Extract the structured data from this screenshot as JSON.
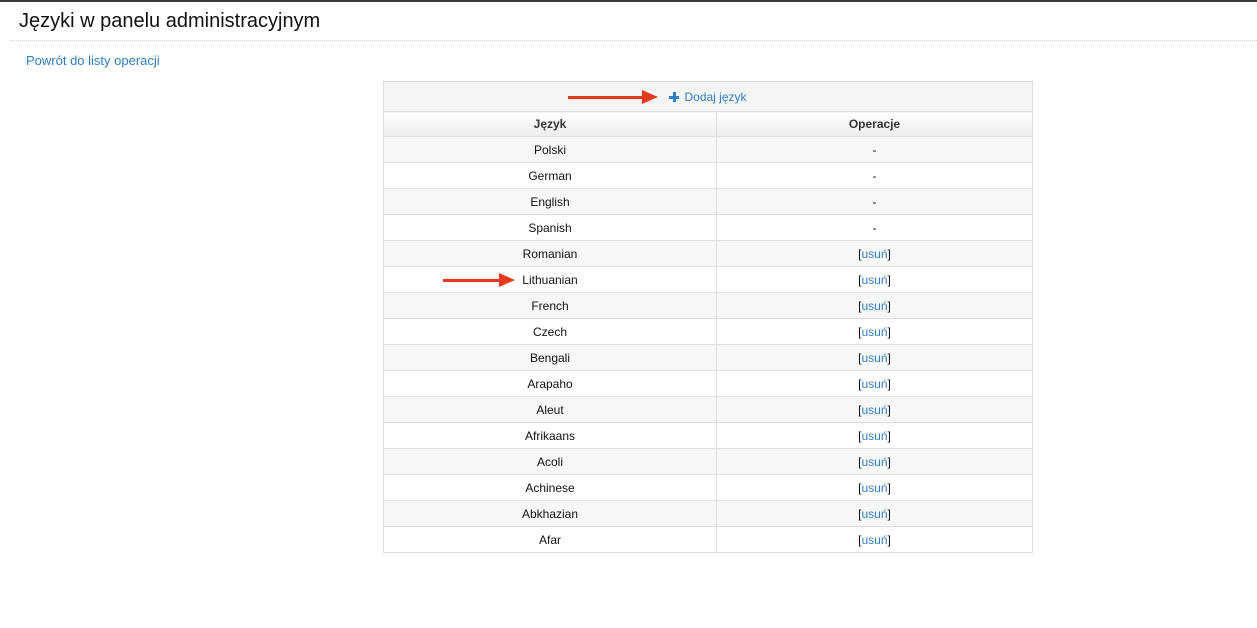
{
  "page": {
    "title": "Języki w panelu administracyjnym",
    "back_link": "Powrót do listy operacji"
  },
  "toolbar": {
    "add_language_label": "Dodaj język"
  },
  "table": {
    "headers": [
      "Język",
      "Operacje"
    ],
    "rows": [
      {
        "language": "Polski",
        "operation": "-",
        "removable": false
      },
      {
        "language": "German",
        "operation": "-",
        "removable": false
      },
      {
        "language": "English",
        "operation": "-",
        "removable": false
      },
      {
        "language": "Spanish",
        "operation": "-",
        "removable": false
      },
      {
        "language": "Romanian",
        "operation": "usuń",
        "removable": true
      },
      {
        "language": "Lithuanian",
        "operation": "usuń",
        "removable": true
      },
      {
        "language": "French",
        "operation": "usuń",
        "removable": true
      },
      {
        "language": "Czech",
        "operation": "usuń",
        "removable": true
      },
      {
        "language": "Bengali",
        "operation": "usuń",
        "removable": true
      },
      {
        "language": "Arapaho",
        "operation": "usuń",
        "removable": true
      },
      {
        "language": "Aleut",
        "operation": "usuń",
        "removable": true
      },
      {
        "language": "Afrikaans",
        "operation": "usuń",
        "removable": true
      },
      {
        "language": "Acoli",
        "operation": "usuń",
        "removable": true
      },
      {
        "language": "Achinese",
        "operation": "usuń",
        "removable": true
      },
      {
        "language": "Abkhazian",
        "operation": "usuń",
        "removable": true
      },
      {
        "language": "Afar",
        "operation": "usuń",
        "removable": true
      }
    ]
  },
  "icons": {
    "add": "plus-icon",
    "annotation": "arrow-icon"
  },
  "colors": {
    "link": "#2f7fc0",
    "annotation_arrow": "#e53a1e"
  }
}
